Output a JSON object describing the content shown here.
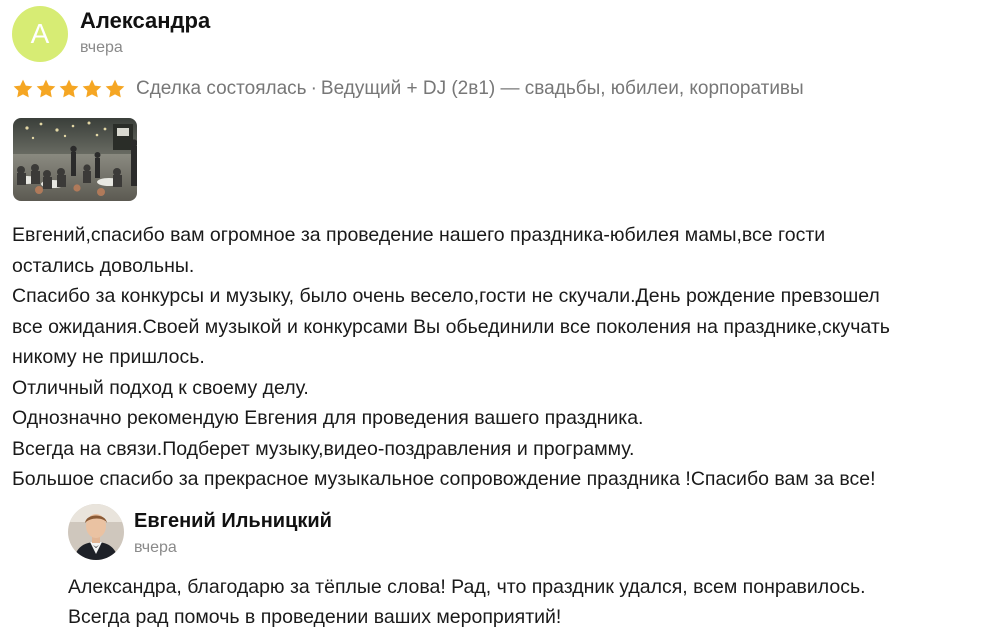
{
  "review": {
    "author": {
      "initial": "А",
      "name": "Александра",
      "date": "вчера",
      "avatar_color": "#d7ec74"
    },
    "rating": {
      "value": 5,
      "max": 5,
      "star_color": "#f5a623",
      "icon": "star-icon"
    },
    "deal_status": "Сделка состоялась",
    "separator": "·",
    "service": "Ведущий + DJ (2в1) — свадьбы, юбилеи, корпоративы",
    "photo": {
      "icon": "event-photo"
    },
    "text_lines": [
      "Евгений,спасибо вам огромное за проведение нашего праздника-юбилея мамы,все гости",
      "остались довольны.",
      "Спасибо за конкурсы и музыку, было очень весело,гости не скучали.День рождение превзошел",
      "все ожидания.Своей музыкой и конкурсами Вы обьединили все поколения на празднике,скучать",
      "никому не пришлось.",
      "Отличный подход к своему делу.",
      "Однозначно рекомендую Евгения для проведения вашего праздника.",
      "Всегда на связи.Подберет музыку,видео-поздравления и программу.",
      "Большое спасибо за прекрасное музыкальное сопровождение праздника !Спасибо вам за все!"
    ]
  },
  "reply": {
    "author": {
      "name": "Евгений Ильницкий",
      "date": "вчера",
      "avatar": "person-avatar-photo"
    },
    "text_lines": [
      "Александра, благодарю за тёплые слова! Рад, что праздник удался, всем понравилось.",
      "Всегда рад помочь в проведении ваших мероприятий!"
    ]
  }
}
